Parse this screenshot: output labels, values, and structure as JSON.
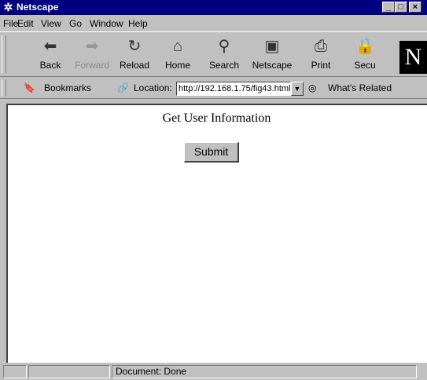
{
  "window": {
    "title": "Netscape"
  },
  "menu": [
    "File",
    "Edit",
    "View",
    "Go",
    "Window",
    "Help"
  ],
  "nav_toolbar": {
    "buttons": [
      {
        "label": "Back",
        "icon": "back-arrow-icon",
        "enabled": true
      },
      {
        "label": "Forward",
        "icon": "forward-arrow-icon",
        "enabled": false
      },
      {
        "label": "Reload",
        "icon": "reload-icon",
        "enabled": true
      },
      {
        "label": "Home",
        "icon": "home-icon",
        "enabled": true
      },
      {
        "label": "Search",
        "icon": "search-icon",
        "enabled": true
      },
      {
        "label": "Netscape",
        "icon": "my-netscape-icon",
        "enabled": true
      },
      {
        "label": "Print",
        "icon": "print-icon",
        "enabled": true
      },
      {
        "label": "Secu",
        "icon": "security-icon",
        "enabled": true
      }
    ]
  },
  "location_bar": {
    "bookmarks_label": "Bookmarks",
    "location_label": "Location:",
    "url": "http://192.168.1.75/fig43.html",
    "whats_related_label": "What's Related"
  },
  "page": {
    "heading": "Get User Information",
    "submit_label": "Submit"
  },
  "status": {
    "text": "Document: Done"
  }
}
